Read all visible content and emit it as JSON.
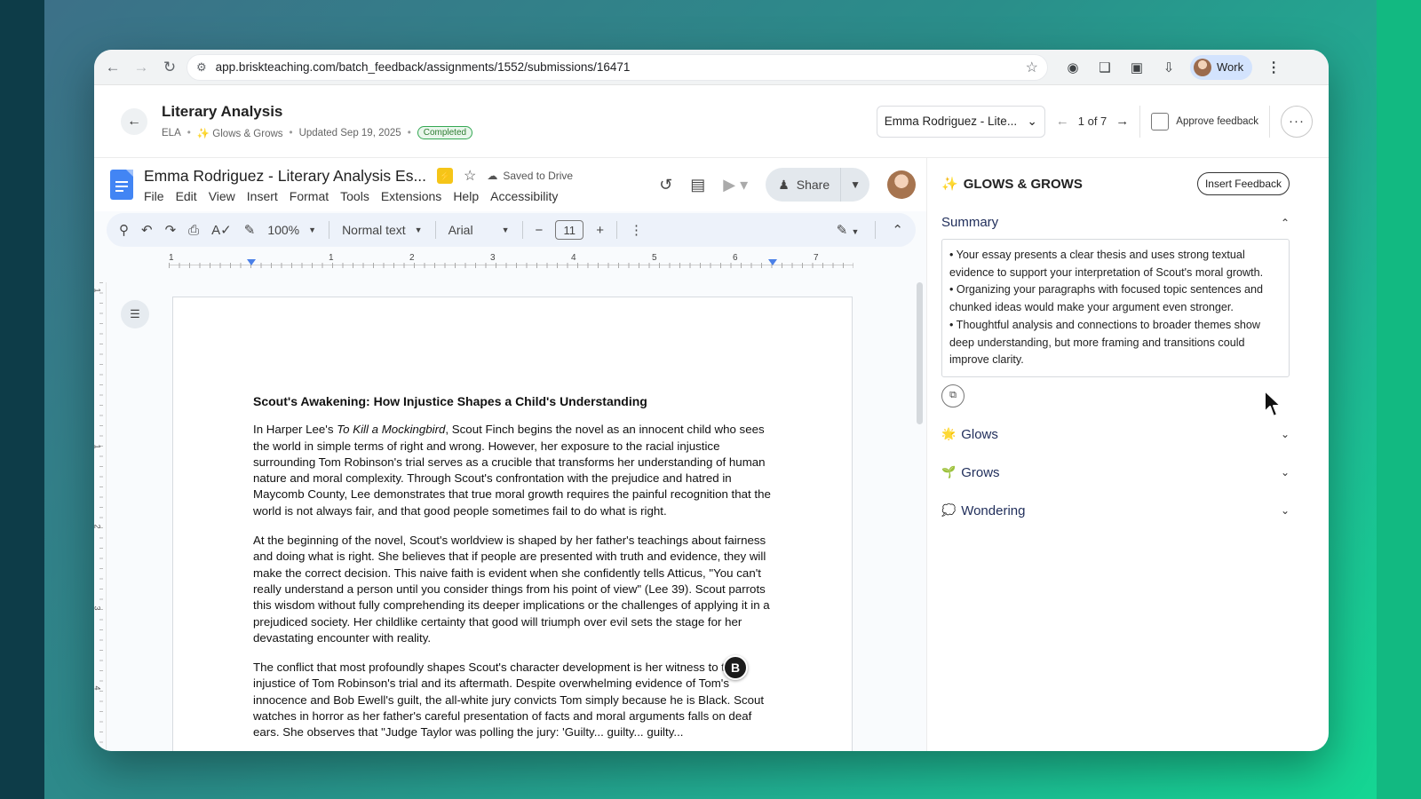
{
  "browser": {
    "url": "app.briskteaching.com/batch_feedback/assignments/1552/submissions/16471",
    "profile_label": "Work"
  },
  "header": {
    "title": "Literary Analysis",
    "subject": "ELA",
    "feedback_type": "✨ Glows & Grows",
    "updated": "Updated Sep 19, 2025",
    "status": "Completed",
    "student_select": "Emma Rodriguez - Lite...",
    "pager": "1 of 7",
    "approve_label": "Approve feedback",
    "more_label": "···"
  },
  "docs": {
    "title": "Emma Rodriguez - Literary Analysis Es...",
    "saved": "Saved to Drive",
    "menus": [
      "File",
      "Edit",
      "View",
      "Insert",
      "Format",
      "Tools",
      "Extensions",
      "Help",
      "Accessibility"
    ],
    "share_label": "Share",
    "toolbar": {
      "zoom": "100%",
      "style": "Normal text",
      "font": "Arial",
      "font_size": "11"
    },
    "ruler_numbers": [
      "1",
      "1",
      "2",
      "3",
      "4",
      "5",
      "6",
      "7"
    ],
    "vruler_numbers": [
      "1",
      "1",
      "2",
      "3",
      "4"
    ],
    "float_badge": "B"
  },
  "essay": {
    "heading": "Scout's Awakening: How Injustice Shapes a Child's Understanding",
    "p1_pre": "In Harper Lee's ",
    "p1_italic": "To Kill a Mockingbird",
    "p1_post": ", Scout Finch begins the novel as an innocent child who sees the world in simple terms of right and wrong. However, her exposure to the racial injustice surrounding Tom Robinson's trial serves as a crucible that transforms her understanding of human nature and moral complexity. Through Scout's confrontation with the prejudice and hatred in Maycomb County, Lee demonstrates that true moral growth requires the painful recognition that the world is not always fair, and that good people sometimes fail to do what is right.",
    "p2": "At the beginning of the novel, Scout's worldview is shaped by her father's teachings about fairness and doing what is right. She believes that if people are presented with truth and evidence, they will make the correct decision. This naive faith is evident when she confidently tells Atticus, \"You can't really understand a person until you consider things from his point of view\" (Lee 39). Scout parrots this wisdom without fully comprehending its deeper implications or the challenges of applying it in a prejudiced society. Her childlike certainty that good will triumph over evil sets the stage for her devastating encounter with reality.",
    "p3": "The conflict that most profoundly shapes Scout's character development is her witness to the injustice of Tom Robinson's trial and its aftermath. Despite overwhelming evidence of Tom's innocence and Bob Ewell's guilt, the all-white jury convicts Tom simply because he is Black. Scout watches in horror as her father's careful presentation of facts and moral arguments falls on deaf ears. She observes that \"Judge Taylor was polling the jury: 'Guilty... guilty... guilty..."
  },
  "side": {
    "title": "GLOWS & GROWS",
    "title_icon": "✨",
    "insert_label": "Insert Feedback",
    "summary_label": "Summary",
    "summary_items": [
      "• Your essay presents a clear thesis and uses strong textual evidence to support your interpretation of Scout's moral growth.",
      "• Organizing your paragraphs with focused topic sentences and chunked ideas would make your argument even stronger.",
      "• Thoughtful analysis and connections to broader themes show deep understanding, but more framing and transitions could improve clarity."
    ],
    "sections": [
      {
        "icon": "🌟",
        "label": "Glows"
      },
      {
        "icon": "🌱",
        "label": "Grows"
      },
      {
        "icon": "💭",
        "label": "Wondering"
      }
    ]
  },
  "colors": {
    "accent_blue": "#4285f4",
    "completed_green": "#34a853",
    "section_text": "#1f2d5a"
  }
}
